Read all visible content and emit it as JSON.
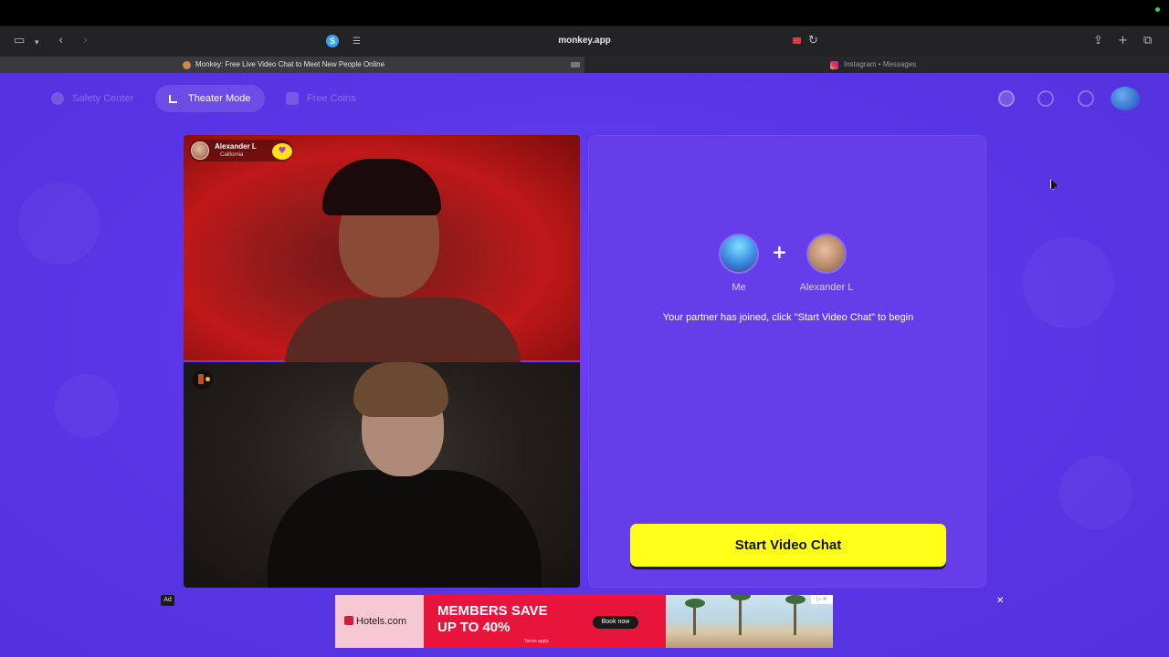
{
  "browser": {
    "url": "monkey.app",
    "s_icon_letter": "S",
    "tabs": [
      {
        "title": "Monkey: Free Live Video Chat to Meet New People Online"
      },
      {
        "title": "Instagram • Messages"
      }
    ]
  },
  "nav": {
    "safety_center": "Safety Center",
    "theater_mode": "Theater Mode",
    "free_coins": "Free Coins"
  },
  "video": {
    "partner_name": "Alexander L",
    "partner_location": "California"
  },
  "panel": {
    "me_label": "Me",
    "plus": "+",
    "partner_label": "Alexander L",
    "message": "Your partner has joined, click \"Start Video Chat\" to begin",
    "start_button": "Start Video Chat"
  },
  "ad": {
    "label": "Ad",
    "brand": "Hotels.com",
    "headline_line1": "MEMBERS SAVE",
    "headline_line2": "UP TO 40%",
    "terms": "Terms apply",
    "cta": "Book now",
    "choices": "▷ ✕",
    "close": "✕"
  },
  "colors": {
    "app_background": "#5a36e6",
    "panel_background": "#653de9",
    "start_button": "#ffff1a",
    "ad_red": "#e8143c"
  }
}
